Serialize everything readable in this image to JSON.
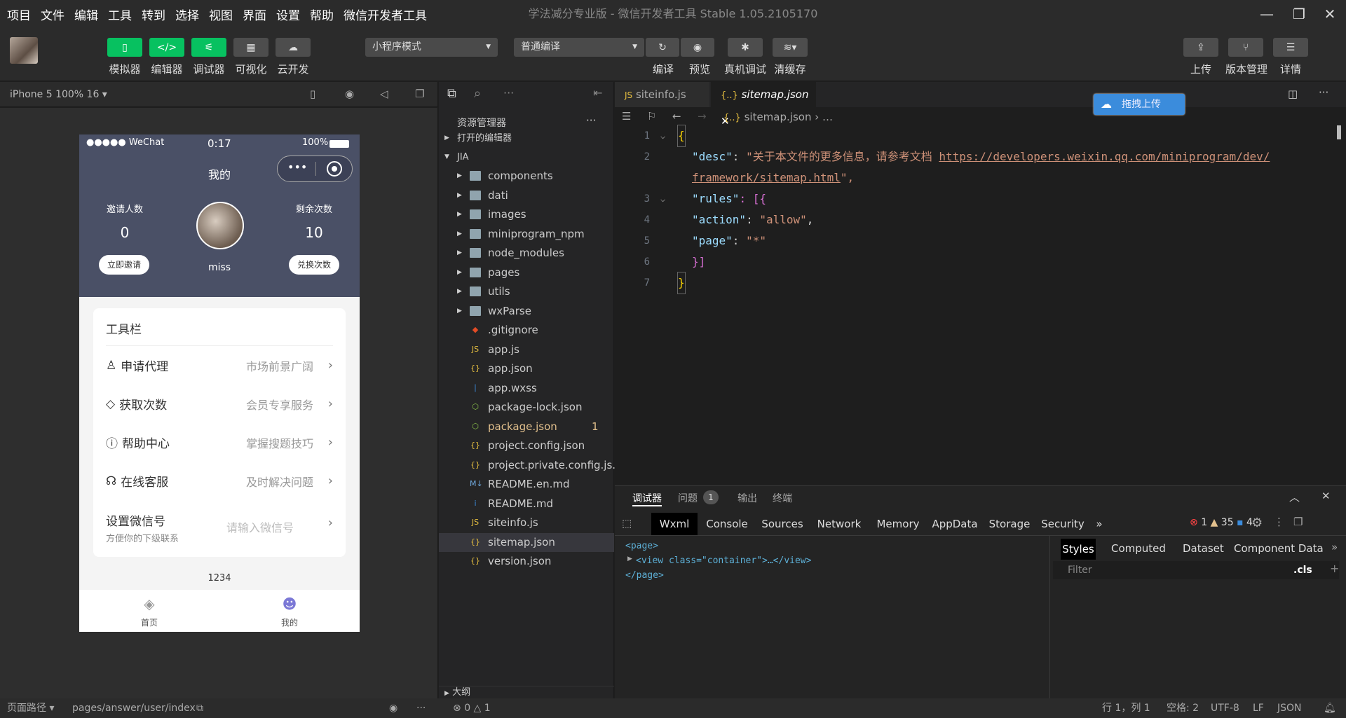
{
  "menu": [
    "项目",
    "文件",
    "编辑",
    "工具",
    "转到",
    "选择",
    "视图",
    "界面",
    "设置",
    "帮助",
    "微信开发者工具"
  ],
  "window_title": "学法减分专业版 - 微信开发者工具 Stable 1.05.2105170",
  "toolbar": {
    "buttons": [
      "模拟器",
      "编辑器",
      "调试器",
      "可视化",
      "云开发"
    ],
    "mode_select": "小程序模式",
    "compile_select": "普通编译",
    "actions": [
      "编译",
      "预览",
      "真机调试",
      "清缓存"
    ],
    "right_actions": [
      "上传",
      "版本管理",
      "详情"
    ]
  },
  "simulator": {
    "device": "iPhone 5 100% 16",
    "status_left": "●●●●● WeChat",
    "status_time": "0:17",
    "status_battery": "100%",
    "nav_title": "我的",
    "invite_label": "邀请人数",
    "invite_count": "0",
    "invite_button": "立即邀请",
    "remain_label": "剩余次数",
    "remain_count": "10",
    "exchange_button": "兑换次数",
    "username": "miss",
    "card_title": "工具栏",
    "rows": [
      {
        "label": "申请代理",
        "value": "市场前景广阔"
      },
      {
        "label": "获取次数",
        "value": "会员专享服务"
      },
      {
        "label": "帮助中心",
        "value": "掌握搜题技巧"
      },
      {
        "label": "在线客服",
        "value": "及时解决问题"
      }
    ],
    "wechat_label": "设置微信号",
    "wechat_sub": "方便你的下级联系",
    "wechat_placeholder": "请输入微信号",
    "footer_number": "1234",
    "tabbar": [
      "首页",
      "我的"
    ]
  },
  "explorer": {
    "title": "资源管理器",
    "open_editors": "打开的编辑器",
    "project": "JIA",
    "folders": [
      "components",
      "dati",
      "images",
      "miniprogram_npm",
      "node_modules",
      "pages",
      "utils",
      "wxParse"
    ],
    "files": [
      ".gitignore",
      "app.js",
      "app.json",
      "app.wxss",
      "package-lock.json",
      "package.json",
      "project.config.json",
      "project.private.config.js...",
      "README.en.md",
      "README.md",
      "siteinfo.js",
      "sitemap.json",
      "version.json"
    ],
    "package_badge": "1",
    "outline": "大纲"
  },
  "editor": {
    "tabs": [
      "siteinfo.js",
      "sitemap.json"
    ],
    "breadcrumb": "sitemap.json",
    "breadcrumb_more": "…",
    "upload_badge": "拖拽上传",
    "lines": [
      {
        "n": "1",
        "text": "{"
      },
      {
        "n": "2",
        "key": "\"desc\"",
        "val": "\"关于本文件的更多信息，请参考文档 ",
        "url": "https://developers.weixin.qq.com/miniprogram/dev/",
        "url2": "framework/sitemap.html",
        "end": "\","
      },
      {
        "n": "3",
        "key": "\"rules\"",
        "rest": ": [{"
      },
      {
        "n": "4",
        "key": "\"action\"",
        "val": "\"allow\"",
        "end": ","
      },
      {
        "n": "5",
        "key": "\"page\"",
        "val": "\"*\""
      },
      {
        "n": "6",
        "text": "}]"
      },
      {
        "n": "7",
        "text": "}"
      }
    ]
  },
  "devtools": {
    "top_tabs": [
      "调试器",
      "问题",
      "输出",
      "终端"
    ],
    "problems_count": "1",
    "tabs": [
      "Wxml",
      "Console",
      "Sources",
      "Network",
      "Memory",
      "AppData",
      "Storage",
      "Security"
    ],
    "more": "»",
    "errors": "1",
    "warnings": "35",
    "infos": "4",
    "wxml": [
      "<page>",
      "<view class=\"container\">…</view>",
      "</page>"
    ],
    "side_tabs": [
      "Styles",
      "Computed",
      "Dataset",
      "Component Data"
    ],
    "filter_placeholder": "Filter",
    "cls": ".cls"
  },
  "statusbar": {
    "path_label": "页面路径",
    "path": "pages/answer/user/index",
    "errors": "0",
    "warnings": "1",
    "position": "行 1，列 1",
    "spaces": "空格: 2",
    "encoding": "UTF-8",
    "eol": "LF",
    "lang": "JSON"
  },
  "colors": {
    "accent": "#07c160",
    "header": "#4a5066",
    "warning": "#e2c08d"
  }
}
